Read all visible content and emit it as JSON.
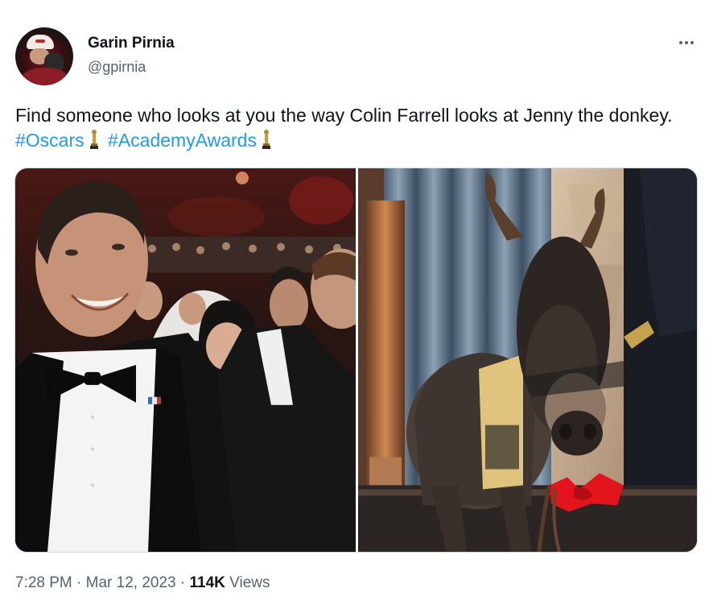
{
  "author": {
    "name": "Garin Pirnia",
    "handle": "@gpirnia"
  },
  "tweet": {
    "text_before": "Find someone who looks at you the way Colin Farrell looks at Jenny the donkey.",
    "hashtag_1": "#Oscars",
    "hashtag_2": "#AcademyAwards",
    "trophy_icon": "oscar-trophy-emoji"
  },
  "media": {
    "image_1_subject": "man in tuxedo smiling in audience",
    "image_2_subject": "donkey with red bow on stage"
  },
  "meta": {
    "time": "7:28 PM",
    "separator": "·",
    "date": "Mar 12, 2023",
    "views_count": "114K",
    "views_label": "Views"
  },
  "colors": {
    "link": "#1d9bf0",
    "secondary_text": "#536471",
    "primary_text": "#0f1419"
  }
}
